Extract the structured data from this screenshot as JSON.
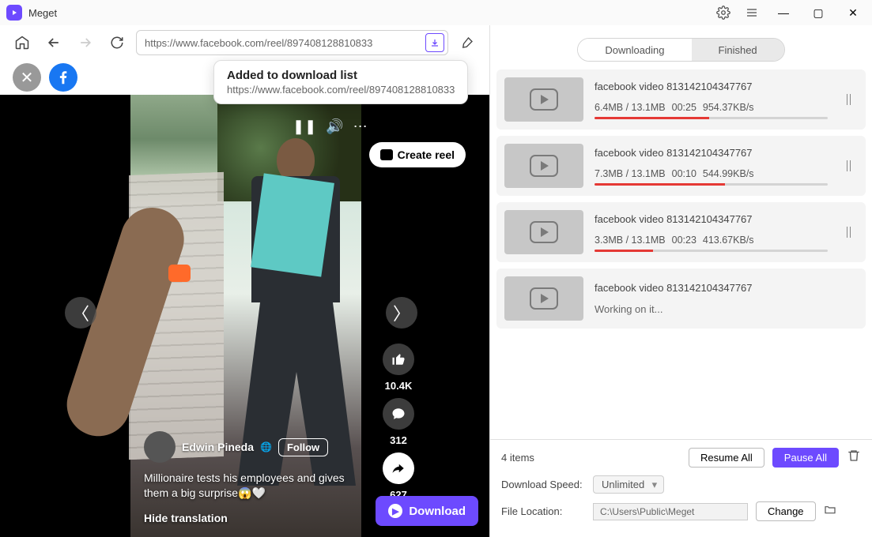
{
  "app": {
    "title": "Meget"
  },
  "toolbar": {
    "url": "https://www.facebook.com/reel/897408128810833"
  },
  "tooltip": {
    "title": "Added to download list",
    "url": "https://www.facebook.com/reel/897408128810833"
  },
  "reel": {
    "create_btn": "Create reel",
    "author": "Edwin Pineda",
    "follow": "Follow",
    "caption": "Millionaire tests his employees and gives them a big surprise😱🤍",
    "hide_translation": "Hide translation",
    "likes": "10.4K",
    "comments": "312",
    "shares": "627",
    "download_btn": "Download"
  },
  "segmented": {
    "downloading": "Downloading",
    "finished": "Finished"
  },
  "downloads": [
    {
      "title": "facebook video 813142104347767",
      "current": "6.4MB",
      "total": "13.1MB",
      "time": "00:25",
      "speed": "954.37KB/s",
      "progress": 49,
      "state": "active"
    },
    {
      "title": "facebook video 813142104347767",
      "current": "7.3MB",
      "total": "13.1MB",
      "time": "00:10",
      "speed": "544.99KB/s",
      "progress": 56,
      "state": "active"
    },
    {
      "title": "facebook video 813142104347767",
      "current": "3.3MB",
      "total": "13.1MB",
      "time": "00:23",
      "speed": "413.67KB/s",
      "progress": 25,
      "state": "active"
    },
    {
      "title": "facebook video 813142104347767",
      "state": "working",
      "working_text": "Working on it..."
    }
  ],
  "footer": {
    "items": "4 items",
    "resume": "Resume All",
    "pause": "Pause All",
    "speed_label": "Download Speed:",
    "speed_value": "Unlimited",
    "location_label": "File Location:",
    "location_value": "C:\\Users\\Public\\Meget",
    "change": "Change"
  }
}
